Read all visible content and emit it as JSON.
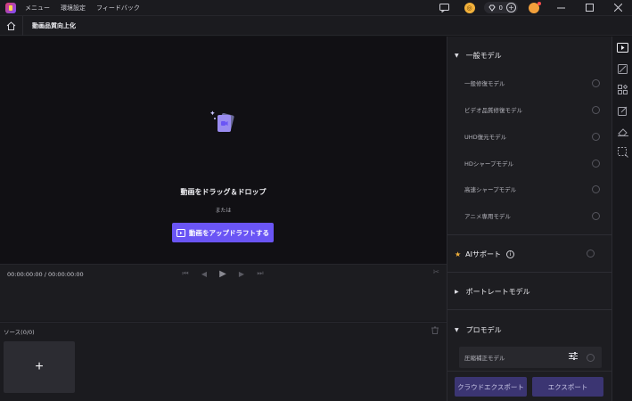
{
  "titlebar": {
    "menu": [
      "メニュー",
      "環境設定",
      "フィードバック"
    ],
    "credits": "0"
  },
  "navbar": {
    "title": "動画品質向上化"
  },
  "preview": {
    "drop_text": "動画をドラッグ＆ドロップ",
    "or_text": "または",
    "upload_button": "動画をアップドラフトする"
  },
  "player": {
    "timecode": "00:00:00:00 / 00:00:00:00"
  },
  "source": {
    "label": "ソース(0/0)",
    "add_label": "+"
  },
  "models": {
    "general": {
      "title": "一般モデル",
      "items": [
        "一般修復モデル",
        "ビデオ品質修復モデル",
        "UHD復元モデル",
        "HDシャープモデル",
        "高速シャープモデル",
        "アニメ専用モデル"
      ]
    },
    "ai_support": {
      "title": "AIサポート",
      "info": "i"
    },
    "portrait": {
      "title": "ポートレートモデル"
    },
    "pro": {
      "title": "プロモデル",
      "items": [
        "圧縮補正モデル"
      ]
    }
  },
  "export": {
    "cloud_label": "クラウドエクスポート",
    "export_label": "エクスポート"
  },
  "colors": {
    "accent": "#6a55f5",
    "export_bg": "#3b3572",
    "star": "#f2b13b"
  }
}
